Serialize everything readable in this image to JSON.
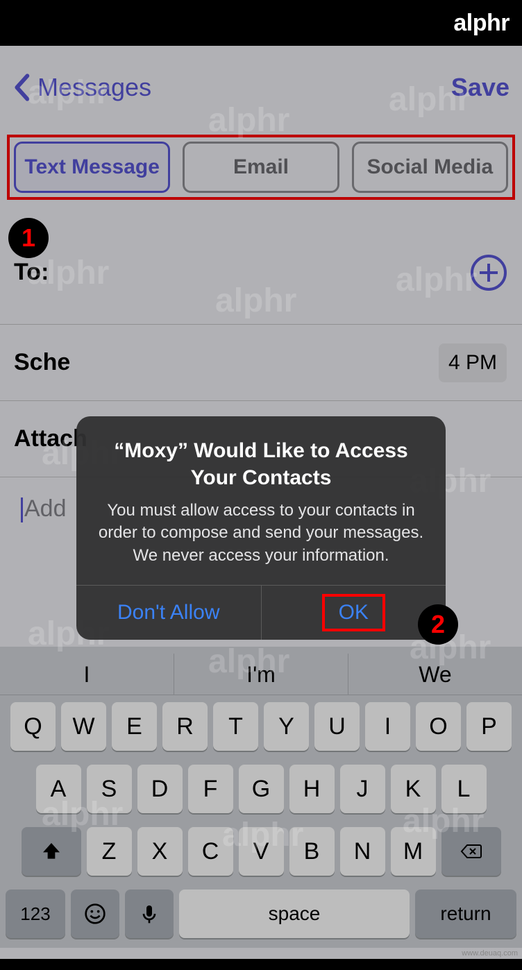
{
  "logo": "alphr",
  "nav": {
    "back": "Messages",
    "save": "Save"
  },
  "tabs": [
    "Text Message",
    "Email",
    "Social Media"
  ],
  "to_label": "To:",
  "schedule": {
    "label": "Sche",
    "value": "4 PM"
  },
  "attachment_label": "Attach",
  "compose_placeholder": "Add",
  "suggestions": [
    "I",
    "I'm",
    "We"
  ],
  "keys": {
    "row1": [
      "Q",
      "W",
      "E",
      "R",
      "T",
      "Y",
      "U",
      "I",
      "O",
      "P"
    ],
    "row2": [
      "A",
      "S",
      "D",
      "F",
      "G",
      "H",
      "J",
      "K",
      "L"
    ],
    "row3": [
      "Z",
      "X",
      "C",
      "V",
      "B",
      "N",
      "M"
    ],
    "num": "123",
    "space": "space",
    "return": "return"
  },
  "alert": {
    "title": "“Moxy” Would Like to Access Your Contacts",
    "message": "You must allow access to your contacts in order to compose and send your messages. We never access your information.",
    "deny": "Don't Allow",
    "allow": "OK"
  },
  "annotations": {
    "step1": "1",
    "step2": "2"
  },
  "credit": "www.deuaq.com"
}
